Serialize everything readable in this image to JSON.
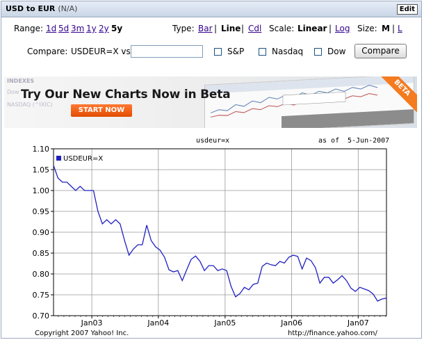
{
  "title": {
    "symbol": "USD to EUR",
    "status": "(N/A)",
    "edit_label": "Edit"
  },
  "range": {
    "label": "Range:",
    "options": [
      "1d",
      "5d",
      "3m",
      "1y",
      "2y"
    ],
    "selected": "5y"
  },
  "type": {
    "label": "Type:",
    "bar": "Bar",
    "sep1": "|",
    "line": "Line",
    "sep2": "|",
    "cdl": "Cdl"
  },
  "scale": {
    "label": "Scale:",
    "linear": "Linear",
    "sep": "|",
    "log": "Log"
  },
  "size": {
    "label": "Size:",
    "m": "M",
    "sep": "|",
    "l": "L"
  },
  "compare": {
    "label": "Compare:",
    "symbol_vs": "USDEUR=X vs",
    "input_value": "",
    "sp": "S&P",
    "nasdaq": "Nasdaq",
    "dow": "Dow",
    "button": "Compare"
  },
  "banner": {
    "index_header": "INDEXES",
    "row1": "Dow",
    "row2": "NASDAQ (^IXIC)",
    "headline": "Try Our New Charts Now in Beta",
    "cta": "START NOW",
    "ribbon": "BETA"
  },
  "chart_header": {
    "ticker": "usdeur=x",
    "as_of_label": "as of",
    "as_of_date": "5-Jun-2007"
  },
  "footer": {
    "copyright": "Copyright 2007 Yahoo! Inc.",
    "url": "http://finance.yahoo.com/"
  },
  "colors": {
    "line": "#2020c0",
    "title_bg": "#c9d5e6",
    "cta": "#f47b20"
  },
  "chart_data": {
    "type": "line",
    "series": [
      {
        "name": "USDEUR=X",
        "values": [
          1.06,
          1.03,
          1.02,
          1.02,
          1.01,
          1.0,
          1.01,
          1.0,
          1.0,
          1.0,
          0.95,
          0.92,
          0.93,
          0.92,
          0.93,
          0.92,
          0.88,
          0.845,
          0.86,
          0.87,
          0.87,
          0.917,
          0.88,
          0.865,
          0.857,
          0.84,
          0.81,
          0.805,
          0.808,
          0.784,
          0.81,
          0.835,
          0.843,
          0.83,
          0.808,
          0.82,
          0.82,
          0.808,
          0.812,
          0.808,
          0.77,
          0.745,
          0.753,
          0.768,
          0.762,
          0.775,
          0.778,
          0.818,
          0.826,
          0.822,
          0.82,
          0.83,
          0.826,
          0.84,
          0.845,
          0.842,
          0.812,
          0.838,
          0.832,
          0.815,
          0.778,
          0.792,
          0.792,
          0.778,
          0.786,
          0.796,
          0.784,
          0.766,
          0.758,
          0.768,
          0.764,
          0.76,
          0.752,
          0.735,
          0.74,
          0.742
        ]
      }
    ],
    "x_start": "2002-06-05",
    "x_end": "2007-06-05",
    "x_ticks": [
      "Jan03",
      "Jan04",
      "Jan05",
      "Jan06",
      "Jan07"
    ],
    "y_ticks": [
      0.7,
      0.75,
      0.8,
      0.85,
      0.9,
      0.95,
      1.0,
      1.05,
      1.1
    ],
    "ylim": [
      0.7,
      1.1
    ],
    "grid": true,
    "legend": "top-left"
  }
}
